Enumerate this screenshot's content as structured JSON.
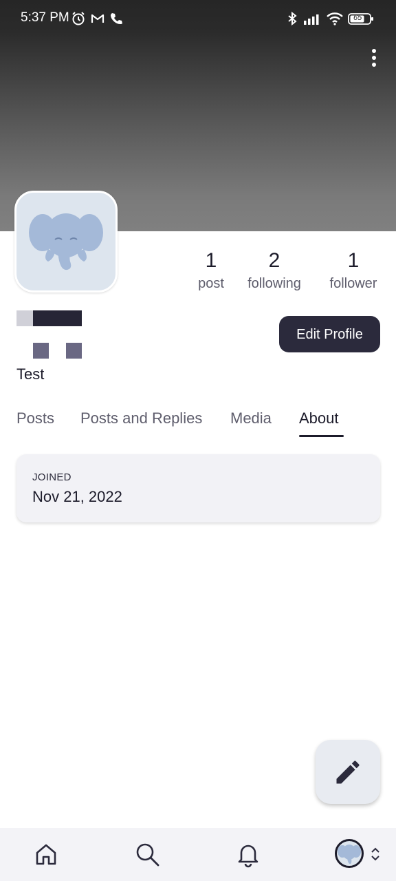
{
  "status_bar": {
    "time": "5:37 PM",
    "battery": "65"
  },
  "profile": {
    "bio": "Test"
  },
  "stats": [
    {
      "value": "1",
      "label": "post"
    },
    {
      "value": "2",
      "label": "following"
    },
    {
      "value": "1",
      "label": "follower"
    }
  ],
  "actions": {
    "edit_profile": "Edit Profile"
  },
  "tabs": [
    {
      "label": "Posts"
    },
    {
      "label": "Posts and Replies"
    },
    {
      "label": "Media"
    },
    {
      "label": "About"
    }
  ],
  "about": {
    "joined_label": "JOINED",
    "joined_date": "Nov 21, 2022"
  },
  "icons": {
    "status": [
      "alarm-icon",
      "gmail-icon",
      "phone-icon",
      "bluetooth-icon",
      "signal-icon",
      "wifi-icon",
      "battery-icon"
    ],
    "nav": [
      "home-icon",
      "search-icon",
      "bell-icon",
      "avatar",
      "chevron-updown-icon"
    ],
    "fab": "pencil-icon"
  },
  "colors": {
    "accent": "#2b2a3c",
    "avatar_bg": "#dde5ee",
    "elephant": "#a4b9d8"
  }
}
